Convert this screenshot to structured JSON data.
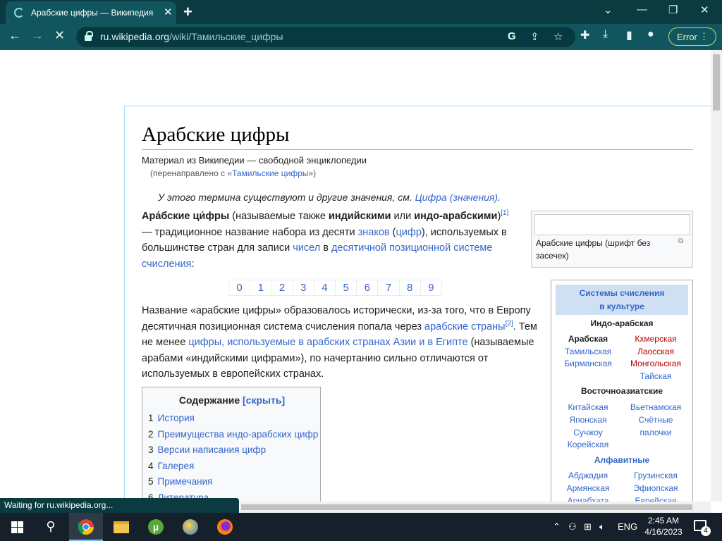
{
  "browser": {
    "tab_title": "Арабские цифры — Википедия",
    "url_host": "ru.wikipedia.org",
    "url_path": "/wiki/Тамильские_цифры",
    "error_label": "Error",
    "status_text": "Waiting for ru.wikipedia.org..."
  },
  "article": {
    "title": "Арабские цифры",
    "tagline": "Материал из Википедии — свободной энциклопедии",
    "redirect_prefix": "(перенаправлено с «",
    "redirect_link": "Тамильские цифры",
    "redirect_suffix": "»)",
    "hatnote_text": "У этого термина существуют и другие значения, см. ",
    "hatnote_link": "Цифра (значения)",
    "hatnote_end": ".",
    "p1": {
      "b1": "Ара́бские ци́фры",
      "t1": " (называемые также ",
      "b2": "индийскими",
      "t2": " или ",
      "b3": "индо-арабскими",
      "t3": ")",
      "ref1": "[1]",
      "t4": " — традиционное название набора из десяти ",
      "l1": "знаков",
      "t5": " (",
      "l2": "цифр",
      "t6": "), используемых в большинстве стран для записи ",
      "l3": "чисел",
      "t7": " в ",
      "l4": "десятичной позиционной системе счисления",
      "t8": ":"
    },
    "digits": [
      "0",
      "1",
      "2",
      "3",
      "4",
      "5",
      "6",
      "7",
      "8",
      "9"
    ],
    "p2": {
      "t1": "Название «арабские цифры» образовалось исторически, из-за того, что в Европу десятичная позиционная система счисления попала через ",
      "l1": "арабские страны",
      "ref": "[2]",
      "t2": ". Тем не менее ",
      "l2": "цифры, используемые в арабских странах Азии и в Египте",
      "t3": " (называемые арабами «индийскими цифрами»), по начертанию сильно отличаются от используемых в европейских странах."
    },
    "thumb_caption": "Арабские цифры (шрифт без засечек)",
    "navbox": {
      "title_line1": "Системы счисления",
      "title_line2": "в культуре",
      "g1": "Индо-арабская",
      "g1_items": [
        "Арабская",
        "Кхмерская",
        "Тамильская",
        "Лаосская",
        "Бирманская",
        "Монгольская",
        "Тайская"
      ],
      "g2": "Восточноазиатские",
      "g2_items": [
        "Китайская",
        "Вьетнамская",
        "Японская",
        "Счётные",
        "Сучжоу",
        "палочки",
        "Корейская"
      ],
      "g3": "Алфавитные",
      "g3_items": [
        "Абджадия",
        "Грузинская",
        "Армянская",
        "Эфиопская",
        "Ариабхата",
        "Еврейская"
      ]
    },
    "toc": {
      "title": "Содержание",
      "toggle": "[скрыть]",
      "items": [
        {
          "num": "1",
          "label": "История"
        },
        {
          "num": "2",
          "label": "Преимущества индо-арабских цифр"
        },
        {
          "num": "3",
          "label": "Версии написания цифр"
        },
        {
          "num": "4",
          "label": "Галерея"
        },
        {
          "num": "5",
          "label": "Примечания"
        },
        {
          "num": "6",
          "label": "Литература"
        }
      ]
    }
  },
  "taskbar": {
    "lang": "ENG",
    "time": "2:45 AM",
    "date": "4/16/2023",
    "notif_count": "4"
  }
}
